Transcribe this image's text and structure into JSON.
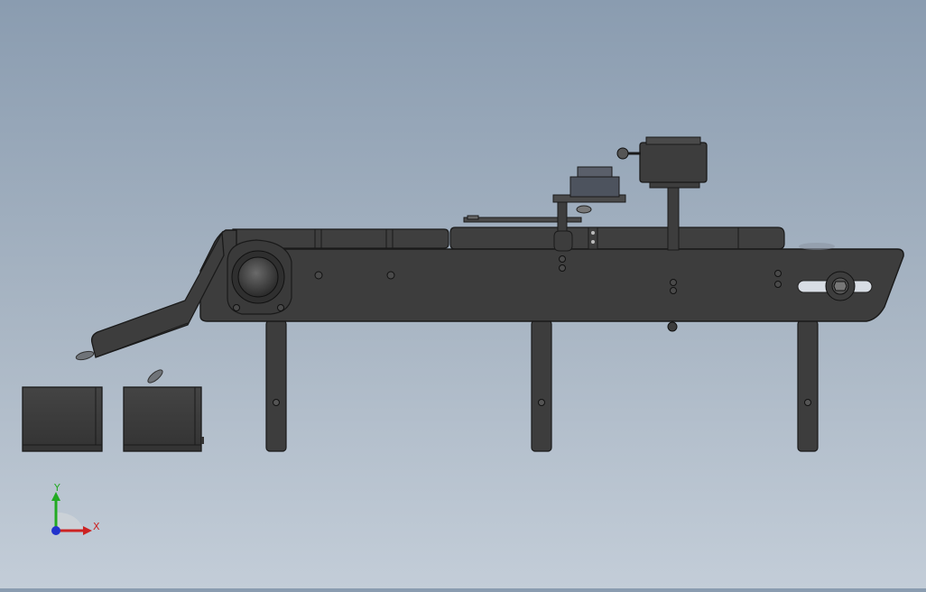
{
  "viewport": {
    "background_top": "#8a9cb0",
    "background_bottom": "#c3cdd8",
    "part_color": "#3d3d3d",
    "edge_color": "#1a1a1a",
    "highlight_color": "#d8dde4"
  },
  "model": {
    "parts": [
      "conveyor-frame",
      "conveyor-belt",
      "drive-roller",
      "discharge-chute",
      "support-leg",
      "collection-bin",
      "motor",
      "sensor-bracket",
      "tension-adjuster"
    ]
  },
  "triad": {
    "x_label": "X",
    "y_label": "Y",
    "x_color": "#cc2222",
    "y_color": "#22aa22",
    "z_color": "#2233cc"
  }
}
